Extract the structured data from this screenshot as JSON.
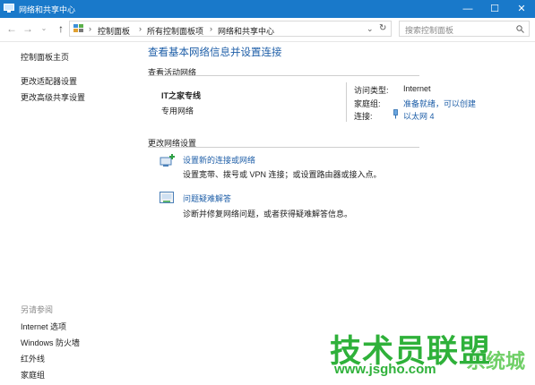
{
  "window": {
    "title": "网络和共享中心",
    "controls": {
      "minimize": "—",
      "maximize": "☐",
      "close": "✕"
    }
  },
  "addressbar": {
    "breadcrumbs": [
      "控制面板",
      "所有控制面板项",
      "网络和共享中心"
    ],
    "search_placeholder": "搜索控制面板"
  },
  "sidebar": {
    "links": [
      "控制面板主页",
      "更改适配器设置",
      "更改高级共享设置"
    ],
    "see_also_heading": "另请参阅",
    "see_also": [
      "Internet 选项",
      "Windows 防火墙",
      "红外线",
      "家庭组"
    ]
  },
  "main": {
    "title": "查看基本网络信息并设置连接",
    "active_networks_heading": "查看活动网络",
    "network": {
      "name": "IT之家专线",
      "type": "专用网络",
      "access_type_label": "访问类型:",
      "access_type_value": "Internet",
      "homegroup_label": "家庭组:",
      "homegroup_value": "准备就绪，可以创建",
      "connection_label": "连接:",
      "connection_value": "以太网 4"
    },
    "change_settings_heading": "更改网络设置",
    "tasks": [
      {
        "title": "设置新的连接或网络",
        "desc": "设置宽带、拨号或 VPN 连接；或设置路由器或接入点。"
      },
      {
        "title": "问题疑难解答",
        "desc": "诊断并修复网络问题，或者获得疑难解答信息。"
      }
    ]
  },
  "watermark": {
    "brand": "技术员联盟",
    "url": "www.jsgho.com",
    "side": "系统城"
  },
  "colors": {
    "titlebar": "#1979ca",
    "link": "#1f5fa8",
    "watermark": "#2fb13a"
  }
}
